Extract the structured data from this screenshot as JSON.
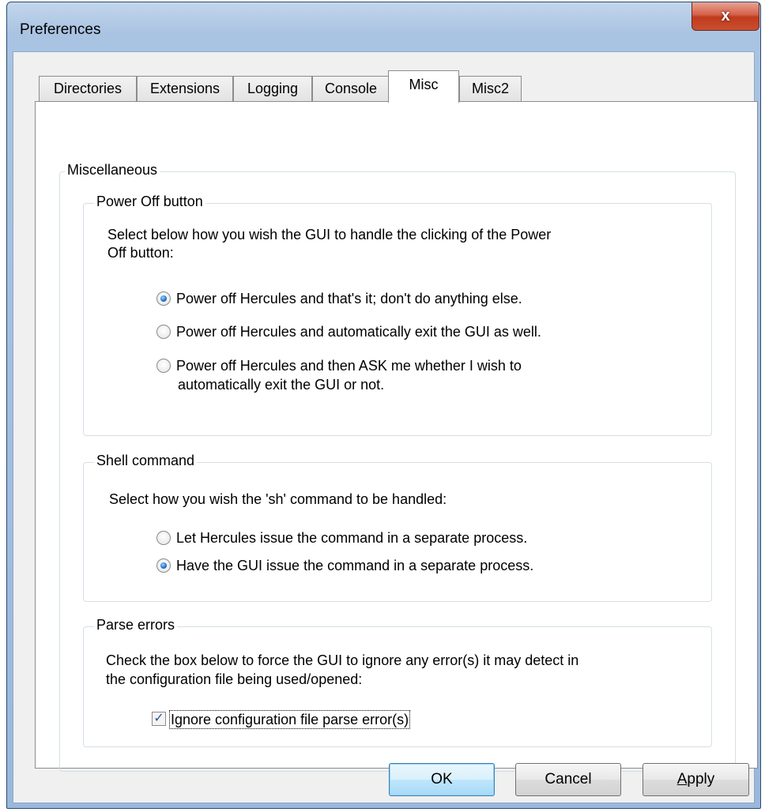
{
  "window": {
    "title": "Preferences",
    "close_glyph": "x"
  },
  "tabs": [
    {
      "label": "Directories"
    },
    {
      "label": "Extensions"
    },
    {
      "label": "Logging"
    },
    {
      "label": "Console"
    },
    {
      "label": "Misc",
      "active": true
    },
    {
      "label": "Misc2"
    }
  ],
  "misc": {
    "group_title": "Miscellaneous",
    "power_off": {
      "title": "Power Off button",
      "description_line1": "Select below how you wish the GUI to handle the clicking of the Power",
      "description_line2": "Off button:",
      "options": [
        {
          "label": "Power off Hercules and that's it; don't do anything else.",
          "checked": true
        },
        {
          "label": "Power off Hercules and automatically exit the GUI as well.",
          "checked": false
        },
        {
          "label_line1": "Power off Hercules and then ASK me whether I wish to",
          "label_line2": "automatically exit the GUI or not.",
          "checked": false
        }
      ]
    },
    "shell": {
      "title": "Shell command",
      "description": "Select how you wish the 'sh' command to be handled:",
      "options": [
        {
          "label": "Let Hercules issue the command in a separate process.",
          "checked": false
        },
        {
          "label": "Have the GUI issue the command in a separate process.",
          "checked": true
        }
      ]
    },
    "parse_errors": {
      "title": "Parse errors",
      "description_line1": "Check the box below to force the GUI to ignore any error(s) it may detect in",
      "description_line2": "the configuration file being used/opened:",
      "checkbox_label": "Ignore configuration file parse error(s)",
      "checked": true
    }
  },
  "buttons": {
    "ok": "OK",
    "cancel": "Cancel",
    "apply_first": "A",
    "apply_rest": "pply"
  },
  "colors": {
    "titlebar": "#a9c3e2",
    "close_button": "#c8502f",
    "dialog_bg": "#f0f0f0",
    "default_button": "#bee6fd"
  }
}
